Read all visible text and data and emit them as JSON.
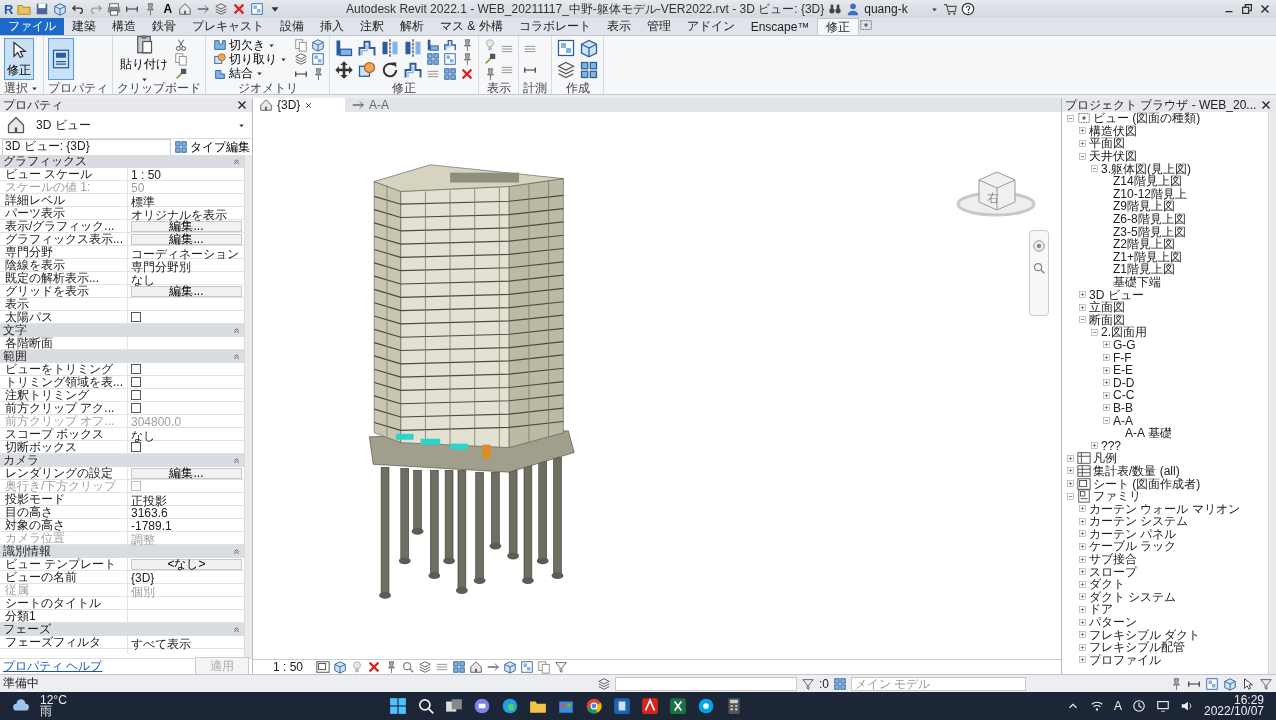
{
  "title_bar": {
    "logo": "R",
    "text_tool": "A",
    "title": "Autodesk Revit 2022.1 - WEB_20211117_中野-躯体モデル-VER2022.rvt - 3D ビュー: {3D}",
    "user": "quang-k"
  },
  "ribbon": {
    "tabs": [
      {
        "label": "ファイル",
        "kind": "menu",
        "selected": false
      },
      {
        "label": "建築",
        "kind": "tab",
        "selected": false
      },
      {
        "label": "構造",
        "kind": "tab",
        "selected": false
      },
      {
        "label": "鉄骨",
        "kind": "tab",
        "selected": false
      },
      {
        "label": "プレキャスト",
        "kind": "tab",
        "selected": false
      },
      {
        "label": "設備",
        "kind": "tab",
        "selected": false
      },
      {
        "label": "挿入",
        "kind": "tab",
        "selected": false
      },
      {
        "label": "注釈",
        "kind": "tab",
        "selected": false
      },
      {
        "label": "解析",
        "kind": "tab",
        "selected": false
      },
      {
        "label": "マス & 外構",
        "kind": "tab",
        "selected": false
      },
      {
        "label": "コラボレート",
        "kind": "tab",
        "selected": false
      },
      {
        "label": "表示",
        "kind": "tab",
        "selected": false
      },
      {
        "label": "管理",
        "kind": "tab",
        "selected": false
      },
      {
        "label": "アドイン",
        "kind": "tab",
        "selected": false
      },
      {
        "label": "Enscape™",
        "kind": "tab",
        "selected": false
      },
      {
        "label": "修正",
        "kind": "tab",
        "selected": true
      }
    ],
    "panels": [
      {
        "title": "選択",
        "menu": true,
        "tools": [
          {
            "label": "修正",
            "selected": true
          }
        ]
      },
      {
        "title": "プロパティ",
        "menu": false,
        "tools": [
          {
            "selected": true
          }
        ]
      },
      {
        "title": "クリップボード",
        "menu": false,
        "tools": [
          {
            "label": "貼り付け",
            "selected": false
          }
        ]
      },
      {
        "title": "ジオメトリ",
        "menu": false,
        "tools": [
          {
            "label": "切欠き",
            "selected": false
          },
          {
            "label": "切り取り",
            "selected": false
          },
          {
            "label": "結合",
            "selected": false
          }
        ]
      },
      {
        "title": "修正",
        "menu": false
      },
      {
        "title": "表示",
        "menu": false
      },
      {
        "title": "計測",
        "menu": false
      },
      {
        "title": "作成",
        "menu": false
      }
    ]
  },
  "properties": {
    "title": "プロパティ",
    "type_name": "3D ビュー",
    "instance": "3D ビュー: {3D}",
    "edit_type": "タイプ編集",
    "groups": [
      {
        "name": "グラフィックス",
        "expanded": true,
        "rows": [
          {
            "label": "ビュー スケール",
            "kind": "text",
            "value": "1 : 50",
            "disabled": false
          },
          {
            "label": "スケールの値    1:",
            "kind": "text",
            "value": "50",
            "disabled": true
          },
          {
            "label": "詳細レベル",
            "kind": "text",
            "value": "標準",
            "disabled": false
          },
          {
            "label": "パーツ表示",
            "kind": "text",
            "value": "オリジナルを表示",
            "disabled": false
          },
          {
            "label": "表示/グラフィック...",
            "kind": "button",
            "value": "編集...",
            "disabled": false
          },
          {
            "label": "グラフィックス表示...",
            "kind": "button",
            "value": "編集...",
            "disabled": false
          },
          {
            "label": "専門分野",
            "kind": "text",
            "value": "コーディネーション",
            "disabled": false
          },
          {
            "label": "陰線を表示",
            "kind": "text",
            "value": "専門分野別",
            "disabled": false
          },
          {
            "label": "既定の解析表示...",
            "kind": "text",
            "value": "なし",
            "disabled": false
          },
          {
            "label": "グリッドを表示",
            "kind": "button",
            "value": "編集...",
            "disabled": false
          },
          {
            "label": "表示",
            "kind": "text",
            "disabled": false
          },
          {
            "label": "太陽パス",
            "kind": "checkbox",
            "checked": false,
            "disabled": false
          }
        ]
      },
      {
        "name": "文字",
        "expanded": true,
        "rows": [
          {
            "label": "各階断面",
            "kind": "text",
            "disabled": false
          }
        ]
      },
      {
        "name": "範囲",
        "expanded": true,
        "rows": [
          {
            "label": "ビューをトリミング",
            "kind": "checkbox",
            "checked": false,
            "disabled": false
          },
          {
            "label": "トリミング領域を表...",
            "kind": "checkbox",
            "checked": false,
            "disabled": false
          },
          {
            "label": "注釈トリミング",
            "kind": "checkbox",
            "checked": false,
            "disabled": false
          },
          {
            "label": "前方クリップ アク...",
            "kind": "checkbox",
            "checked": false,
            "disabled": false
          },
          {
            "label": "前方クリップ オフ...",
            "kind": "text",
            "value": "304800.0",
            "disabled": true
          },
          {
            "label": "スコープ ボックス",
            "kind": "text",
            "value": "なし",
            "disabled": false
          },
          {
            "label": "切断ボックス",
            "kind": "checkbox",
            "checked": false,
            "disabled": false
          }
        ]
      },
      {
        "name": "カメラ",
        "expanded": true,
        "rows": [
          {
            "label": "レンダリングの設定",
            "kind": "button",
            "value": "編集...",
            "disabled": false
          },
          {
            "label": "奥行き/下方クリップ",
            "kind": "checkbox",
            "checked": false,
            "disabled": true
          },
          {
            "label": "投影モード",
            "kind": "text",
            "value": "正投影",
            "disabled": false
          },
          {
            "label": "目の高さ",
            "kind": "text",
            "value": "3163.6",
            "disabled": false
          },
          {
            "label": "対象の高さ",
            "kind": "text",
            "value": "-1789.1",
            "disabled": false
          },
          {
            "label": "カメラ位置",
            "kind": "text",
            "value": "調整",
            "disabled": true
          }
        ]
      },
      {
        "name": "識別情報",
        "expanded": true,
        "rows": [
          {
            "label": "ビュー テンプレート",
            "kind": "button",
            "value": "<なし>",
            "disabled": false
          },
          {
            "label": "ビューの名前",
            "kind": "text",
            "value": "{3D}",
            "disabled": false
          },
          {
            "label": "従属",
            "kind": "text",
            "value": "個別",
            "disabled": true
          },
          {
            "label": "シートのタイトル",
            "kind": "text",
            "disabled": false
          },
          {
            "label": "分類1",
            "kind": "text",
            "disabled": false
          }
        ]
      },
      {
        "name": "フェーズ",
        "expanded": true,
        "rows": [
          {
            "label": "フェーズフィルタ",
            "kind": "text",
            "value": "すべて表示",
            "disabled": false
          }
        ]
      }
    ],
    "help": "プロパティ ヘルプ",
    "apply": {
      "label": "適用",
      "disabled": true
    }
  },
  "view": {
    "tabs": [
      {
        "label": "{3D}",
        "selected": true
      },
      {
        "label": "A-A",
        "selected": false
      }
    ],
    "view_cube": "右",
    "scale": "1 : 50"
  },
  "browser": {
    "title": "プロジェクト ブラウザ - WEB_20...",
    "tree": [
      {
        "label": "ビュー (図面の種類)",
        "kind": "views",
        "expanded": true,
        "children": [
          {
            "label": "構造伏図",
            "expanded": false
          },
          {
            "label": "平面図",
            "expanded": false
          },
          {
            "label": "天井伏図",
            "expanded": true,
            "children": [
              {
                "label": "3.躯体図(見上図)",
                "expanded": true,
                "children": [
                  {
                    "label": "Z14階見上図"
                  },
                  {
                    "label": "Z10-12階見上"
                  },
                  {
                    "label": "Z9階見上図"
                  },
                  {
                    "label": "Z6-8階見上図"
                  },
                  {
                    "label": "Z3-5階見上図"
                  },
                  {
                    "label": "Z2階見上図"
                  },
                  {
                    "label": "Z1+階見上図"
                  },
                  {
                    "label": "Z1階見上図"
                  },
                  {
                    "label": "基礎下端"
                  }
                ]
              }
            ]
          },
          {
            "label": "3D ビュー",
            "expanded": false
          },
          {
            "label": "立面図",
            "expanded": false
          },
          {
            "label": "断面図",
            "expanded": true,
            "children": [
              {
                "label": "2.図面用",
                "expanded": true,
                "children": [
                  {
                    "label": "G-G",
                    "expanded": false
                  },
                  {
                    "label": "F-F",
                    "expanded": false
                  },
                  {
                    "label": "E-E",
                    "expanded": false
                  },
                  {
                    "label": "D-D",
                    "expanded": false
                  },
                  {
                    "label": "C-C",
                    "expanded": false
                  },
                  {
                    "label": "B-B",
                    "expanded": false
                  },
                  {
                    "label": "A-A",
                    "expanded": true,
                    "children": [
                      {
                        "label": "A-A 基礎"
                      }
                    ]
                  }
                ]
              },
              {
                "label": "???",
                "expanded": false
              }
            ]
          }
        ]
      },
      {
        "label": "凡例",
        "kind": "legend",
        "expanded": false
      },
      {
        "label": "集計表/数量 (all)",
        "kind": "schedule",
        "expanded": false
      },
      {
        "label": "シート (図面作成者)",
        "kind": "sheet",
        "expanded": false
      },
      {
        "label": "ファミリ",
        "kind": "family",
        "expanded": true,
        "children": [
          {
            "label": "カーテン ウォール マリオン",
            "expanded": false
          },
          {
            "label": "カーテン システム",
            "expanded": false
          },
          {
            "label": "カーテン パネル",
            "expanded": false
          },
          {
            "label": "ケーブル ラック",
            "expanded": false
          },
          {
            "label": "サブ接合",
            "expanded": false
          },
          {
            "label": "スロープ",
            "expanded": false
          },
          {
            "label": "ダクト",
            "expanded": false
          },
          {
            "label": "ダクト システム",
            "expanded": false
          },
          {
            "label": "ドア",
            "expanded": false
          },
          {
            "label": "パターン",
            "expanded": false
          },
          {
            "label": "フレキシブル ダクト",
            "expanded": false
          },
          {
            "label": "フレキシブル配管",
            "expanded": false
          },
          {
            "label": "プロファイル",
            "expanded": false
          }
        ]
      }
    ]
  },
  "status_bar": {
    "message": "準備中",
    "filter_count": ":0",
    "workset": "メイン モデル"
  },
  "taskbar": {
    "temperature": "12°C",
    "weather": "雨",
    "ime": "A",
    "time": "16:29",
    "date": "2022/10/07"
  }
}
